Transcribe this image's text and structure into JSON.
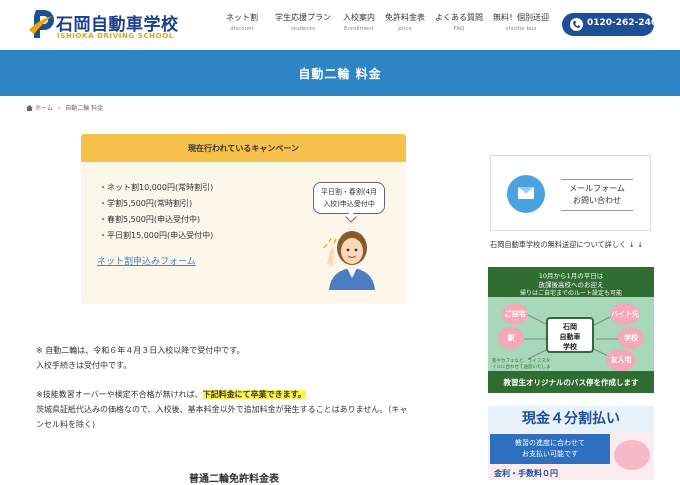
{
  "header": {
    "logo_name": "石岡自動車学校",
    "logo_sub": "ISHIOKA DRIVING SCHOOL",
    "nav": [
      {
        "label": "ネット割",
        "sub": "discount"
      },
      {
        "label": "学生応援プラン",
        "sub": "students"
      },
      {
        "label": "入校案内",
        "sub": "Enrollment"
      },
      {
        "label": "免許料金表",
        "sub": "price"
      },
      {
        "label": "よくある質問",
        "sub": "FAQ"
      },
      {
        "label": "無料！個別送迎",
        "sub": "shuttle bus"
      }
    ],
    "phone": "0120-262-246"
  },
  "banner": {
    "title": "自動二輪 料金"
  },
  "breadcrumb": {
    "home": "ホーム",
    "current": "自動二輪 料金"
  },
  "campaign": {
    "title": "現在行われているキャンペーン",
    "items": [
      "・ネット割10,000円(常時割引)",
      "・学割5,500円(常時割引)",
      "・春割5,500円(申込受付中)",
      "・平日割15,000円(申込受付中)"
    ],
    "link": "ネット割申込みフォーム",
    "speech_line1": "平日割・春割(4月",
    "speech_line2": "入校)申込受付中"
  },
  "notes": {
    "line1": "※ 自動二輪は、令和６年４月３日入校以降で受付中です。",
    "line2": "入校手続きは受付中です。",
    "line3_pre": "※技能教習オーバーや検定不合格が無ければ、",
    "line3_hl": "下記料金にて卒業できます。",
    "line4": "茨城県証紙代込みの価格なので、入校後、基本料金以外で追加料金が発生することはありません。（キャ",
    "line5": "ンセル料を除く)"
  },
  "section_title": "普通二輪免許料金表",
  "sidebar": {
    "mail_line1": "メールフォーム",
    "mail_line2": "お問い合わせ",
    "shuttle_text": "石岡自動車学校の無料送迎について詳しく ↓ ↓",
    "bus": {
      "top1": "10月から1月の平日は",
      "top2": "放課後高校へのお迎え",
      "top3": "帰りはご自宅までのルート設定も可能",
      "center_1": "石岡",
      "center_2": "自動車",
      "center_3": "学校",
      "nodes": [
        "ご自宅",
        "バイト先",
        "駅",
        "学校",
        "友人宅"
      ],
      "note": "塾やカフェなど、ライフスタイルに合わせて送迎いたします",
      "bottom": "教習生オリジナルのバス停を作成します"
    },
    "pay": {
      "title": "現金４分割払い",
      "box_line1": "教習の進度に合わせて",
      "box_line2": "お支払い可能です",
      "fee": "金利・手数料０円"
    }
  },
  "colors": {
    "brand_blue": "#1d4f97",
    "banner_blue": "#2e84c4",
    "campaign_yellow": "#f7c04a",
    "highlight": "#fff34d"
  }
}
